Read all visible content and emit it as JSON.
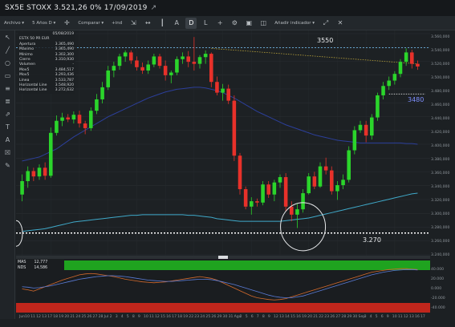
{
  "window": {
    "title": "SX5E STOXX 3.521,26 0% 17/09/2019",
    "window_icon": "external-link-icon"
  },
  "toolbar": {
    "items": [
      {
        "label": "Archivo",
        "type": "menu"
      },
      {
        "label": "5 Años D",
        "type": "menu"
      },
      {
        "label": "Comparar",
        "type": "menu"
      },
      {
        "label": "+ind",
        "type": "text"
      },
      {
        "label": "A",
        "type": "toggle"
      },
      {
        "label": "D",
        "type": "toggle",
        "active": true
      },
      {
        "label": "L",
        "type": "toggle"
      },
      {
        "label": "Añadir indicador",
        "type": "menu"
      }
    ],
    "icons": [
      "crosshair-icon",
      "expand-icon",
      "fx-icon",
      "bars-icon",
      "gear-icon",
      "camera-icon",
      "fullscreen-icon",
      "close-icon"
    ]
  },
  "left_tools": [
    "pointer-icon",
    "line-icon",
    "circle-icon",
    "rectangle-icon",
    "lines-icon",
    "fibonacci-icon",
    "trend-icon",
    "text-icon",
    "eraser-icon",
    "trash-icon",
    "pencil-icon"
  ],
  "legend": {
    "date": "05/08/2019",
    "name": "ESTX 50 PR EUR",
    "rows": [
      {
        "label": "Apertura",
        "value": "3.365,490"
      },
      {
        "label": "Máximo",
        "value": "3.365,490"
      },
      {
        "label": "Mínimo",
        "value": "3.302,300"
      },
      {
        "label": "Cierre",
        "value": "3.310,930"
      },
      {
        "label": "Volumen",
        "value": "-"
      },
      {
        "label": "Mov5",
        "value": "3.484,517"
      },
      {
        "label": "Mov5",
        "value": "3.293,436"
      },
      {
        "label": "Línea",
        "value": "3.533,787"
      },
      {
        "label": "Horizontal Line",
        "value": "3.548,920"
      },
      {
        "label": "Horizontal Line",
        "value": "3.272,632"
      }
    ]
  },
  "price_labels": {
    "top": "3550",
    "mid": "3480",
    "bottom": "3.270"
  },
  "indicator_legend": [
    {
      "label": "MAS",
      "value": "12,777"
    },
    {
      "label": "NDS",
      "value": "14,586"
    }
  ],
  "price_axis": [
    "3.560,000",
    "3.540,000",
    "3.520,000",
    "3.500,000",
    "3.480,000",
    "3.460,000",
    "3.440,000",
    "3.420,000",
    "3.400,000",
    "3.380,000",
    "3.360,000",
    "3.340,000",
    "3.320,000",
    "3.300,000",
    "3.280,000",
    "3.260,000",
    "3.240,000"
  ],
  "indicator_axis": [
    "40.000",
    "20.000",
    "0.000",
    "-20.000",
    "-40.000"
  ],
  "date_axis": [
    "Jun",
    "10",
    "11",
    "12",
    "13",
    "17",
    "18",
    "19",
    "20",
    "21",
    "24",
    "25",
    "26",
    "27",
    "28",
    "Jul",
    "2",
    "3",
    "4",
    "5",
    "8",
    "9",
    "10",
    "11",
    "12",
    "15",
    "16",
    "17",
    "18",
    "19",
    "22",
    "23",
    "24",
    "25",
    "26",
    "29",
    "30",
    "31",
    "Ago",
    "2",
    "5",
    "6",
    "7",
    "8",
    "9",
    "12",
    "13",
    "14",
    "15",
    "16",
    "19",
    "20",
    "21",
    "22",
    "23",
    "26",
    "27",
    "28",
    "29",
    "30",
    "Sep",
    "3",
    "4",
    "5",
    "6",
    "9",
    "10",
    "11",
    "12",
    "13",
    "16",
    "17"
  ],
  "colors": {
    "up": "#2bd52b",
    "down": "#e8312a",
    "ma_slow": "#3fa9c9",
    "ma_fast": "#2c3f9a",
    "trend": "#b9a23a",
    "hline": "#ffffff",
    "hline_blue": "#78c8ff",
    "ind_top": "#1fa31f",
    "ind_bottom": "#c0261c",
    "osc_a": "#d46a2c",
    "osc_b": "#5a7bd6"
  },
  "chart_data": {
    "type": "candlestick",
    "title": "SX5E STOXX",
    "ylim": [
      3240,
      3570
    ],
    "h_lines": [
      3548.92,
      3272.632,
      3480
    ],
    "ohlc": [
      [
        3330,
        3360,
        3320,
        3350
      ],
      [
        3350,
        3372,
        3340,
        3365
      ],
      [
        3365,
        3370,
        3350,
        3357
      ],
      [
        3357,
        3375,
        3352,
        3370
      ],
      [
        3370,
        3378,
        3352,
        3358
      ],
      [
        3358,
        3430,
        3355,
        3422
      ],
      [
        3422,
        3448,
        3418,
        3440
      ],
      [
        3440,
        3452,
        3432,
        3445
      ],
      [
        3445,
        3450,
        3438,
        3442
      ],
      [
        3442,
        3454,
        3436,
        3449
      ],
      [
        3449,
        3455,
        3430,
        3436
      ],
      [
        3436,
        3440,
        3420,
        3429
      ],
      [
        3429,
        3460,
        3425,
        3455
      ],
      [
        3455,
        3480,
        3450,
        3472
      ],
      [
        3472,
        3498,
        3466,
        3490
      ],
      [
        3490,
        3522,
        3486,
        3515
      ],
      [
        3515,
        3528,
        3505,
        3522
      ],
      [
        3522,
        3540,
        3516,
        3536
      ],
      [
        3536,
        3545,
        3528,
        3542
      ],
      [
        3542,
        3545,
        3525,
        3530
      ],
      [
        3530,
        3536,
        3515,
        3520
      ],
      [
        3520,
        3527,
        3510,
        3515
      ],
      [
        3515,
        3530,
        3510,
        3524
      ],
      [
        3524,
        3540,
        3520,
        3536
      ],
      [
        3536,
        3540,
        3518,
        3522
      ],
      [
        3522,
        3530,
        3500,
        3508
      ],
      [
        3508,
        3515,
        3496,
        3512
      ],
      [
        3512,
        3536,
        3508,
        3532
      ],
      [
        3532,
        3542,
        3525,
        3536
      ],
      [
        3536,
        3544,
        3520,
        3528
      ],
      [
        3528,
        3565,
        3515,
        3525
      ],
      [
        3525,
        3538,
        3518,
        3535
      ],
      [
        3535,
        3545,
        3525,
        3540
      ],
      [
        3540,
        3542,
        3490,
        3498
      ],
      [
        3498,
        3506,
        3478,
        3482
      ],
      [
        3482,
        3495,
        3470,
        3488
      ],
      [
        3488,
        3494,
        3465,
        3470
      ],
      [
        3470,
        3478,
        3380,
        3388
      ],
      [
        3388,
        3392,
        3330,
        3338
      ],
      [
        3338,
        3342,
        3308,
        3312
      ],
      [
        3312,
        3326,
        3300,
        3320
      ],
      [
        3320,
        3324,
        3312,
        3318
      ],
      [
        3318,
        3350,
        3314,
        3345
      ],
      [
        3345,
        3350,
        3325,
        3330
      ],
      [
        3330,
        3352,
        3320,
        3348
      ],
      [
        3348,
        3360,
        3340,
        3356
      ],
      [
        3356,
        3362,
        3305,
        3312
      ],
      [
        3312,
        3320,
        3290,
        3300
      ],
      [
        3300,
        3316,
        3280,
        3308
      ],
      [
        3308,
        3338,
        3303,
        3332
      ],
      [
        3332,
        3362,
        3330,
        3357
      ],
      [
        3357,
        3364,
        3338,
        3342
      ],
      [
        3342,
        3378,
        3340,
        3372
      ],
      [
        3372,
        3385,
        3360,
        3366
      ],
      [
        3366,
        3372,
        3330,
        3335
      ],
      [
        3335,
        3350,
        3322,
        3344
      ],
      [
        3344,
        3360,
        3338,
        3352
      ],
      [
        3352,
        3402,
        3348,
        3396
      ],
      [
        3396,
        3432,
        3390,
        3426
      ],
      [
        3426,
        3440,
        3422,
        3434
      ],
      [
        3434,
        3440,
        3408,
        3418
      ],
      [
        3418,
        3450,
        3412,
        3445
      ],
      [
        3445,
        3482,
        3440,
        3478
      ],
      [
        3478,
        3498,
        3472,
        3492
      ],
      [
        3492,
        3506,
        3486,
        3500
      ],
      [
        3500,
        3514,
        3494,
        3510
      ],
      [
        3510,
        3532,
        3505,
        3528
      ],
      [
        3528,
        3548,
        3522,
        3542
      ],
      [
        3542,
        3546,
        3518,
        3525
      ],
      [
        3525,
        3530,
        3516,
        3521
      ]
    ],
    "ma_slow": [
      3275,
      3276,
      3277,
      3278,
      3279,
      3281,
      3283,
      3285,
      3287,
      3289,
      3290,
      3291,
      3292,
      3293,
      3294,
      3295,
      3296,
      3297,
      3298,
      3299,
      3299,
      3300,
      3300,
      3300,
      3300,
      3300,
      3300,
      3300,
      3300,
      3299,
      3299,
      3298,
      3297,
      3296,
      3294,
      3293,
      3292,
      3291,
      3290,
      3290,
      3290,
      3290,
      3290,
      3290,
      3290,
      3290,
      3291,
      3292,
      3293,
      3294,
      3295,
      3297,
      3299,
      3301,
      3303,
      3305,
      3307,
      3309,
      3311,
      3313,
      3315,
      3317,
      3319,
      3321,
      3323,
      3325,
      3327,
      3329,
      3331,
      3332
    ],
    "ma_fast": [
      3380,
      3382,
      3384,
      3386,
      3390,
      3394,
      3398,
      3404,
      3410,
      3416,
      3421,
      3426,
      3431,
      3436,
      3441,
      3446,
      3450,
      3454,
      3458,
      3462,
      3466,
      3470,
      3474,
      3477,
      3480,
      3483,
      3485,
      3487,
      3488,
      3489,
      3490,
      3490,
      3489,
      3487,
      3485,
      3482,
      3478,
      3474,
      3469,
      3464,
      3459,
      3454,
      3450,
      3446,
      3442,
      3438,
      3434,
      3431,
      3428,
      3425,
      3422,
      3419,
      3417,
      3415,
      3413,
      3411,
      3410,
      3409,
      3408,
      3407,
      3407,
      3407,
      3407,
      3407,
      3407,
      3407,
      3407,
      3406,
      3406,
      3405
    ],
    "trend_from": [
      33,
      3548
    ],
    "trend_to": [
      69,
      3525
    ],
    "oscillator_a": [
      -10,
      -12,
      -15,
      -10,
      -5,
      0,
      5,
      10,
      14,
      18,
      22,
      24,
      25,
      24,
      22,
      20,
      18,
      15,
      12,
      10,
      8,
      6,
      5,
      4,
      5,
      6,
      8,
      10,
      12,
      14,
      16,
      18,
      16,
      14,
      10,
      4,
      -2,
      -8,
      -14,
      -20,
      -26,
      -30,
      -32,
      -34,
      -35,
      -34,
      -32,
      -28,
      -24,
      -20,
      -16,
      -12,
      -8,
      -4,
      0,
      4,
      8,
      12,
      16,
      20,
      24,
      28,
      30,
      32,
      34,
      35,
      36,
      36,
      35,
      34
    ],
    "oscillator_b": [
      -5,
      -6,
      -8,
      -7,
      -5,
      -3,
      0,
      3,
      6,
      9,
      12,
      14,
      16,
      18,
      19,
      20,
      20,
      19,
      18,
      16,
      14,
      12,
      10,
      9,
      8,
      7,
      7,
      8,
      9,
      10,
      11,
      12,
      12,
      11,
      9,
      6,
      3,
      0,
      -4,
      -8,
      -12,
      -16,
      -20,
      -24,
      -27,
      -29,
      -30,
      -30,
      -28,
      -26,
      -22,
      -18,
      -14,
      -10,
      -6,
      -2,
      2,
      6,
      10,
      14,
      18,
      22,
      25,
      28,
      30,
      32,
      33,
      34,
      34,
      33
    ]
  }
}
